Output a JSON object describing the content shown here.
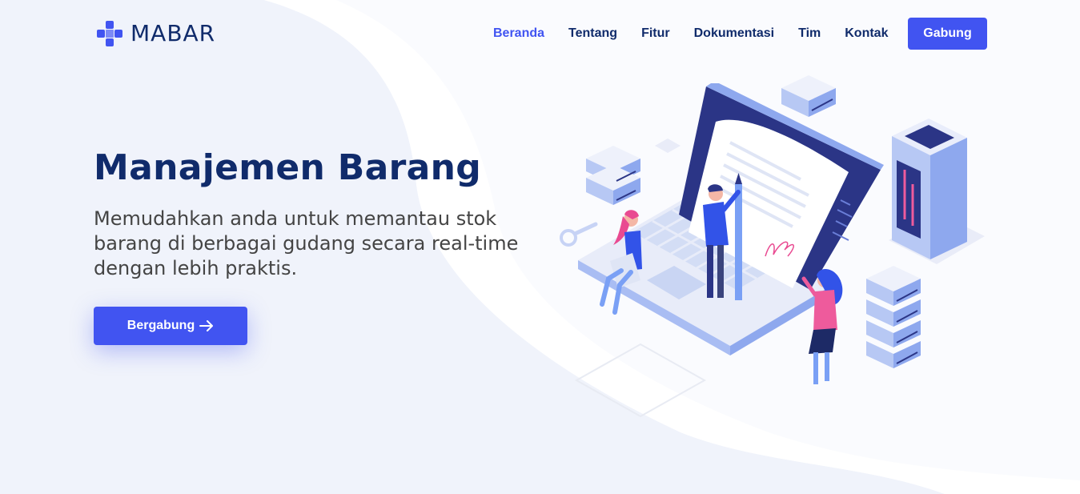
{
  "brand": {
    "name": "MABAR",
    "accent": "#4154f1",
    "heading_color": "#102b6b"
  },
  "nav": {
    "items": [
      {
        "label": "Beranda",
        "active": true
      },
      {
        "label": "Tentang",
        "active": false
      },
      {
        "label": "Fitur",
        "active": false
      },
      {
        "label": "Dokumentasi",
        "active": false
      },
      {
        "label": "Tim",
        "active": false
      },
      {
        "label": "Kontak",
        "active": false
      }
    ],
    "cta_label": "Gabung"
  },
  "hero": {
    "title": "Manajemen Barang",
    "subtitle": "Memudahkan anda untuk memantau stok barang di berbagai gudang secara real-time dengan lebih praktis.",
    "cta_label": "Bergabung",
    "cta_icon": "arrow-right-icon",
    "illustration": "inventory-laptop-illustration"
  }
}
